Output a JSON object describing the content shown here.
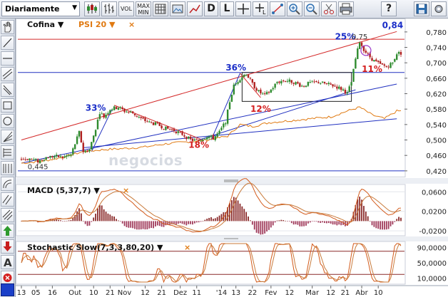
{
  "toolbar": {
    "period_select": "Diariamente",
    "vol_label": "VOL",
    "maxmin_label1": "MAX",
    "maxmin_label2": "MIN",
    "d_label": "D",
    "l_label": "L",
    "help_label": "?"
  },
  "colors": {
    "main_line": "#d42a2a",
    "support_line": "#2030c0",
    "psi_line": "#e07a12",
    "up_candle": "#2e8b2e",
    "down_candle": "#b02020",
    "annot_blue": "#1c2fc8",
    "annot_red": "#d41e1e",
    "osc_line1": "#d35a1a",
    "osc_line2": "#c87a3a"
  },
  "chart_data": [
    {
      "type": "line",
      "panel": "price",
      "title": "Cofina",
      "compare": "PSI 20",
      "y_ticks": [
        "0,780",
        "0,740",
        "0,700",
        "0,660",
        "0,620",
        "0,580",
        "0,540",
        "0,500",
        "0,460",
        "0,420"
      ],
      "ylim": [
        0.405,
        0.8
      ],
      "x_labels": [
        "13",
        "05",
        "16",
        "Out",
        "10",
        "21",
        "Nov",
        "12",
        "21",
        "Dez",
        "11",
        "'14",
        "13",
        "22",
        "Fev",
        "12",
        "Mar",
        "12",
        "21",
        "Abr",
        "10"
      ],
      "x_indices": [
        0,
        7,
        15,
        26,
        35,
        43,
        50,
        60,
        68,
        77,
        85,
        97,
        104,
        112,
        121,
        130,
        141,
        150,
        157,
        165,
        173
      ],
      "n_bars": 185,
      "annotations": [
        {
          "text": "33%",
          "color": "blue",
          "x": 36,
          "y": 0.576
        },
        {
          "text": "36%",
          "color": "blue",
          "x": 104,
          "y": 0.68
        },
        {
          "text": "25%",
          "color": "blue",
          "x": 157,
          "y": 0.76
        },
        {
          "text": "0,84",
          "color": "blue",
          "x": 180,
          "y": 0.79
        },
        {
          "text": "0,75",
          "color": "gray",
          "x": 164,
          "y": 0.761
        },
        {
          "text": "12%",
          "color": "red",
          "x": 116,
          "y": 0.573
        },
        {
          "text": "18%",
          "color": "red",
          "x": 86,
          "y": 0.48
        },
        {
          "text": "11%",
          "color": "red",
          "x": 170,
          "y": 0.676
        },
        {
          "text": "0,445",
          "color": "gray",
          "x": 8,
          "y": 0.424
        }
      ],
      "watermark": "negocios",
      "horizontal_levels": [
        0.761,
        0.675,
        0.42
      ],
      "range_box": [
        0.675,
        0.6
      ],
      "series_points": [
        [
          0,
          0.45
        ],
        [
          4,
          0.452
        ],
        [
          8,
          0.445
        ],
        [
          12,
          0.455
        ],
        [
          16,
          0.458
        ],
        [
          20,
          0.455
        ],
        [
          24,
          0.462
        ],
        [
          26,
          0.49
        ],
        [
          28,
          0.52
        ],
        [
          30,
          0.47
        ],
        [
          33,
          0.475
        ],
        [
          36,
          0.53
        ],
        [
          38,
          0.572
        ],
        [
          40,
          0.56
        ],
        [
          43,
          0.58
        ],
        [
          47,
          0.585
        ],
        [
          50,
          0.575
        ],
        [
          54,
          0.57
        ],
        [
          58,
          0.555
        ],
        [
          62,
          0.545
        ],
        [
          66,
          0.54
        ],
        [
          70,
          0.53
        ],
        [
          74,
          0.525
        ],
        [
          78,
          0.515
        ],
        [
          82,
          0.5
        ],
        [
          86,
          0.498
        ],
        [
          90,
          0.51
        ],
        [
          93,
          0.505
        ],
        [
          96,
          0.52
        ],
        [
          99,
          0.548
        ],
        [
          101,
          0.6
        ],
        [
          103,
          0.64
        ],
        [
          106,
          0.66
        ],
        [
          109,
          0.673
        ],
        [
          112,
          0.645
        ],
        [
          115,
          0.625
        ],
        [
          118,
          0.615
        ],
        [
          121,
          0.63
        ],
        [
          124,
          0.65
        ],
        [
          128,
          0.655
        ],
        [
          132,
          0.65
        ],
        [
          136,
          0.64
        ],
        [
          140,
          0.648
        ],
        [
          144,
          0.65
        ],
        [
          148,
          0.645
        ],
        [
          152,
          0.64
        ],
        [
          156,
          0.63
        ],
        [
          158,
          0.62
        ],
        [
          160,
          0.65
        ],
        [
          162,
          0.71
        ],
        [
          164,
          0.755
        ],
        [
          166,
          0.735
        ],
        [
          168,
          0.72
        ],
        [
          171,
          0.705
        ],
        [
          174,
          0.695
        ],
        [
          177,
          0.69
        ],
        [
          180,
          0.7
        ],
        [
          182,
          0.725
        ]
      ],
      "psi_points": [
        [
          0,
          0.44
        ],
        [
          10,
          0.445
        ],
        [
          20,
          0.455
        ],
        [
          30,
          0.47
        ],
        [
          40,
          0.475
        ],
        [
          50,
          0.478
        ],
        [
          60,
          0.482
        ],
        [
          70,
          0.49
        ],
        [
          80,
          0.495
        ],
        [
          90,
          0.5
        ],
        [
          100,
          0.51
        ],
        [
          106,
          0.54
        ],
        [
          112,
          0.535
        ],
        [
          120,
          0.545
        ],
        [
          130,
          0.55
        ],
        [
          140,
          0.555
        ],
        [
          150,
          0.56
        ],
        [
          158,
          0.575
        ],
        [
          164,
          0.585
        ],
        [
          170,
          0.565
        ],
        [
          176,
          0.555
        ],
        [
          182,
          0.575
        ]
      ]
    },
    {
      "type": "line",
      "panel": "macd",
      "title": "MACD (5,37,7)",
      "y_ticks": [
        "0,0600",
        "0,0200",
        "-0,0200"
      ],
      "ylim": [
        -0.03,
        0.075
      ]
    },
    {
      "type": "line",
      "panel": "stochastic",
      "title": "Stochastic Slow(7,3,3,80,20)",
      "y_ticks": [
        "90,0000",
        "50,0000",
        "10,0000"
      ],
      "ylim": [
        0,
        100
      ]
    }
  ]
}
